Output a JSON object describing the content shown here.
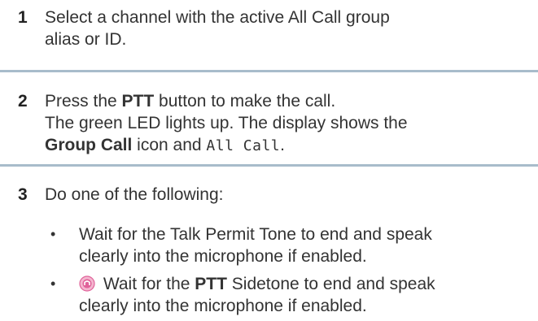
{
  "steps": [
    {
      "number": "1",
      "line1": "Select a channel with the active All Call group",
      "line2": "alias or ID."
    },
    {
      "number": "2",
      "line1_pre": "Press the ",
      "line1_bold": "PTT",
      "line1_post": " button to make the call.",
      "line2": "The green LED lights up. The display shows the",
      "line3_bold": "Group Call",
      "line3_mid": " icon and ",
      "line3_mono": "All Call",
      "line3_end": "."
    },
    {
      "number": "3",
      "line1": "Do one of the following:",
      "bullets": [
        {
          "line1": "Wait for the Talk Permit Tone to end and speak",
          "line2": "clearly into the microphone if enabled."
        },
        {
          "icon": "advanced-feature-icon",
          "line1_pre": " Wait for the ",
          "line1_bold": "PTT",
          "line1_post": " Sidetone to end and speak",
          "line2": "clearly into the microphone if enabled."
        }
      ]
    }
  ],
  "bullet_char": "•",
  "colors": {
    "divider": "#a8bccb",
    "text": "#333333",
    "icon_pink": "#e0629a"
  }
}
